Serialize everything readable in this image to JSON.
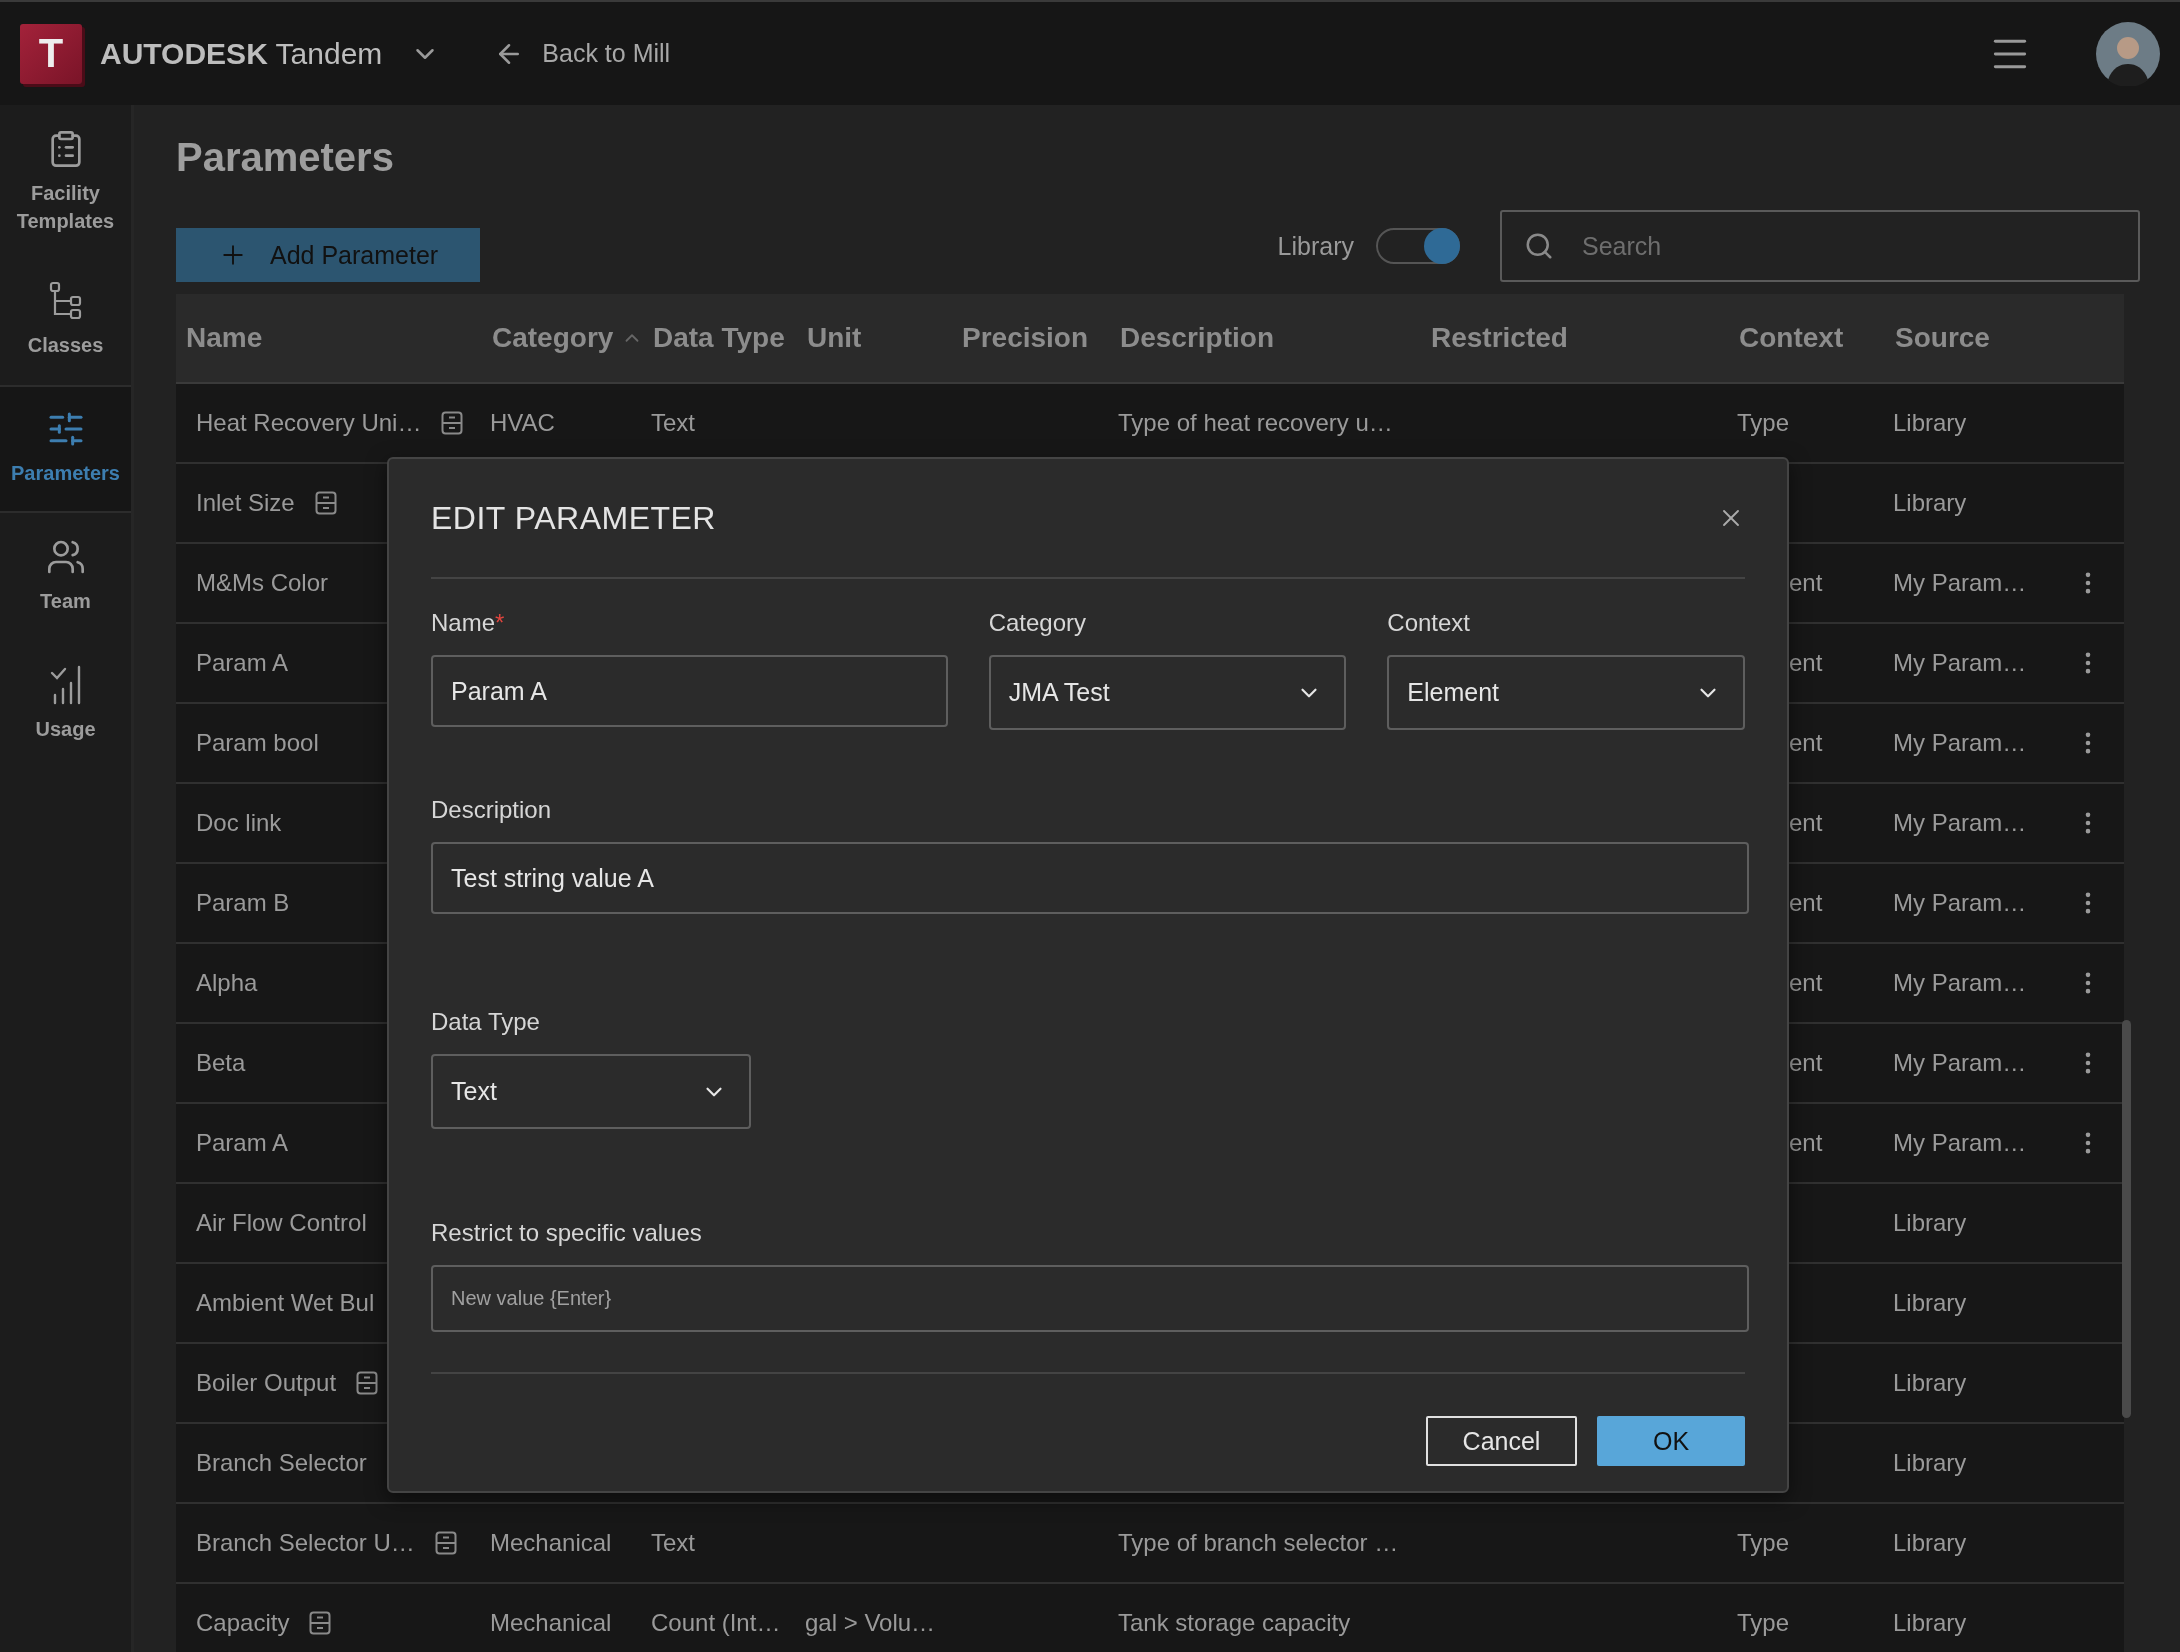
{
  "app_bar": {
    "logo_letter": "T",
    "product": "**AUTODESK** Tandem",
    "back_link": "Back to Mill"
  },
  "sidebar": {
    "items": [
      {
        "label": "Facility Templates",
        "selected": false
      },
      {
        "label": "Classes",
        "selected": false
      },
      {
        "label": "Parameters",
        "selected": true
      },
      {
        "label": "Team",
        "selected": false
      },
      {
        "label": "Usage",
        "selected": false
      }
    ]
  },
  "page": {
    "title": "Parameters",
    "add_button": "Add Parameter",
    "library_toggle": {
      "label": "Library",
      "on": true
    },
    "search": {
      "placeholder": "Search"
    }
  },
  "table": {
    "columns": [
      {
        "label": "Name"
      },
      {
        "label": "Category",
        "sorted": true
      },
      {
        "label": "Data Type"
      },
      {
        "label": "Unit"
      },
      {
        "label": "Precision"
      },
      {
        "label": "Description"
      },
      {
        "label": "Restricted"
      },
      {
        "label": "Context"
      },
      {
        "label": "Source"
      }
    ],
    "rows": [
      {
        "name": "Heat Recovery Uni…",
        "icon": true,
        "category": "HVAC",
        "data_type": "Text",
        "description": "Type of heat recovery u…",
        "context": "Type",
        "source": "Library",
        "menu": false,
        "covered": false
      },
      {
        "name": "Inlet Size",
        "icon": true,
        "source": "Library",
        "menu": false
      },
      {
        "name": "M&Ms Color",
        "icon": false,
        "context": "ent",
        "source": "My Param…",
        "menu": true,
        "covered": true
      },
      {
        "name": "Param A",
        "icon": false,
        "context": "ent",
        "source": "My Param…",
        "menu": true,
        "covered": true
      },
      {
        "name": "Param bool",
        "icon": false,
        "context": "ent",
        "source": "My Param…",
        "menu": true,
        "covered": true
      },
      {
        "name": "Doc link",
        "icon": false,
        "context": "ent",
        "source": "My Param…",
        "menu": true,
        "covered": true
      },
      {
        "name": "Param B",
        "icon": false,
        "context": "ent",
        "source": "My Param…",
        "menu": true,
        "covered": true
      },
      {
        "name": "Alpha",
        "icon": false,
        "context": "ent",
        "source": "My Param…",
        "menu": true,
        "covered": true
      },
      {
        "name": "Beta",
        "icon": false,
        "context": "ent",
        "source": "My Param…",
        "menu": true,
        "covered": true
      },
      {
        "name": "Param A",
        "icon": false,
        "context": "ent",
        "source": "My Param…",
        "menu": true,
        "covered": true
      },
      {
        "name": "Air Flow Control",
        "source": "Library",
        "menu": false
      },
      {
        "name": "Ambient Wet Bul",
        "source": "Library",
        "menu": false
      },
      {
        "name": "Boiler Output",
        "icon": true,
        "source": "Library",
        "menu": false
      },
      {
        "name": "Branch Selector",
        "source": "Library",
        "menu": false
      },
      {
        "name": "Branch Selector U…",
        "icon": true,
        "category": "Mechanical",
        "data_type": "Text",
        "description": "Type of branch selector …",
        "context": "Type",
        "source": "Library",
        "menu": false,
        "covered": false
      },
      {
        "name": "Capacity",
        "icon": true,
        "category": "Mechanical",
        "data_type": "Count (Int…",
        "unit": "gal > Volu…",
        "description": "Tank storage capacity",
        "context": "Type",
        "source": "Library",
        "menu": false,
        "covered": false
      }
    ]
  },
  "dialog": {
    "title": "EDIT PARAMETER",
    "name": {
      "label": "Name",
      "required_mark": "*",
      "value": "Param A"
    },
    "category": {
      "label": "Category",
      "value": "JMA Test"
    },
    "context": {
      "label": "Context",
      "value": "Element"
    },
    "description": {
      "label": "Description",
      "value": "Test string value A"
    },
    "data_type": {
      "label": "Data Type",
      "value": "Text"
    },
    "restrict": {
      "label": "Restrict to specific values",
      "placeholder": "New value {Enter}"
    },
    "buttons": [
      {
        "label": "Cancel",
        "kind": "secondary"
      },
      {
        "label": "OK",
        "kind": "primary"
      }
    ]
  }
}
